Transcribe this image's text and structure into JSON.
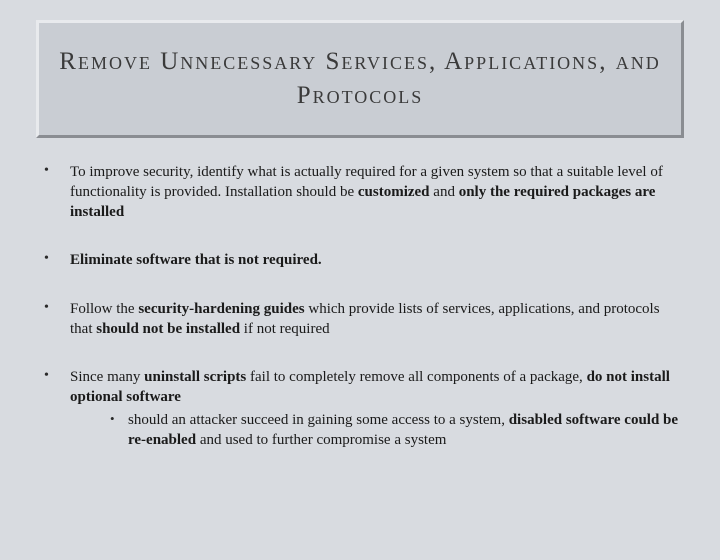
{
  "title": "Remove Unnecessary Services, Applications, and Protocols",
  "bullets": [
    {
      "pre": "To improve security, identify what is actually required for a given system so that a suitable level of functionality is provided. Installation should be ",
      "b1": "customized",
      "mid": " and ",
      "b2": "only the required packages are installed",
      "post": ""
    },
    {
      "b1": "Eliminate software that is not required.",
      "pre": "",
      "mid": "",
      "b2": "",
      "post": ""
    },
    {
      "pre": "Follow the ",
      "b1": "security-hardening guides",
      "mid": " which provide lists of services, applications, and protocols that ",
      "b2": "should not be installed",
      "post": " if not required"
    },
    {
      "pre": "Since many ",
      "b1": "uninstall scripts",
      "mid": " fail to completely remove all components of a package, ",
      "b2": "do not install optional software",
      "post": "",
      "sub": {
        "pre": "should an attacker succeed in gaining some access to a system, ",
        "b1": "disabled software could be re-enabled",
        "post": " and used to further compromise a system"
      }
    }
  ]
}
